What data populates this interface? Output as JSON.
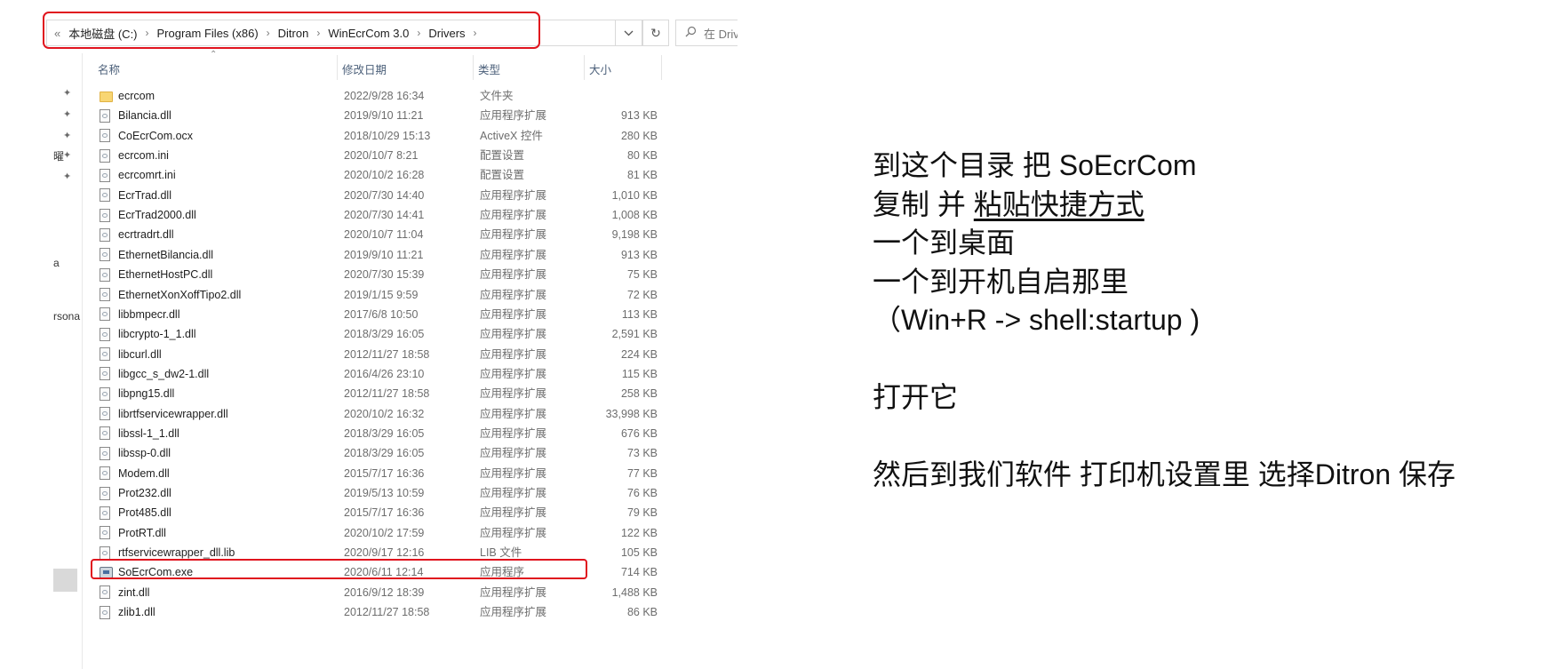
{
  "address_bar": {
    "back_glyph": "«",
    "breadcrumbs": [
      "本地磁盘 (C:)",
      "Program Files (x86)",
      "Ditron",
      "WinEcrCom 3.0",
      "Drivers"
    ],
    "search_placeholder": "在 Driv"
  },
  "nav_pane": {
    "labels": [
      "曜",
      "a",
      "rsona"
    ]
  },
  "columns": {
    "name": "名称",
    "date": "修改日期",
    "type": "类型",
    "size": "大小"
  },
  "files": [
    {
      "name": "ecrcom",
      "date": "2022/9/28 16:34",
      "type": "文件夹",
      "size": "",
      "icon": "folder-icon"
    },
    {
      "name": "Bilancia.dll",
      "date": "2019/9/10 11:21",
      "type": "应用程序扩展",
      "size": "913 KB",
      "icon": "dll-icon"
    },
    {
      "name": "CoEcrCom.ocx",
      "date": "2018/10/29 15:13",
      "type": "ActiveX 控件",
      "size": "280 KB",
      "icon": "ocx-icon"
    },
    {
      "name": "ecrcom.ini",
      "date": "2020/10/7 8:21",
      "type": "配置设置",
      "size": "80 KB",
      "icon": "ini-icon"
    },
    {
      "name": "ecrcomrt.ini",
      "date": "2020/10/2 16:28",
      "type": "配置设置",
      "size": "81 KB",
      "icon": "ini-icon"
    },
    {
      "name": "EcrTrad.dll",
      "date": "2020/7/30 14:40",
      "type": "应用程序扩展",
      "size": "1,010 KB",
      "icon": "dll-icon"
    },
    {
      "name": "EcrTrad2000.dll",
      "date": "2020/7/30 14:41",
      "type": "应用程序扩展",
      "size": "1,008 KB",
      "icon": "dll-icon"
    },
    {
      "name": "ecrtradrt.dll",
      "date": "2020/10/7 11:04",
      "type": "应用程序扩展",
      "size": "9,198 KB",
      "icon": "dll-icon"
    },
    {
      "name": "EthernetBilancia.dll",
      "date": "2019/9/10 11:21",
      "type": "应用程序扩展",
      "size": "913 KB",
      "icon": "dll-icon"
    },
    {
      "name": "EthernetHostPC.dll",
      "date": "2020/7/30 15:39",
      "type": "应用程序扩展",
      "size": "75 KB",
      "icon": "dll-icon"
    },
    {
      "name": "EthernetXonXoffTipo2.dll",
      "date": "2019/1/15 9:59",
      "type": "应用程序扩展",
      "size": "72 KB",
      "icon": "dll-icon"
    },
    {
      "name": "libbmpecr.dll",
      "date": "2017/6/8 10:50",
      "type": "应用程序扩展",
      "size": "113 KB",
      "icon": "dll-icon"
    },
    {
      "name": "libcrypto-1_1.dll",
      "date": "2018/3/29 16:05",
      "type": "应用程序扩展",
      "size": "2,591 KB",
      "icon": "dll-icon"
    },
    {
      "name": "libcurl.dll",
      "date": "2012/11/27 18:58",
      "type": "应用程序扩展",
      "size": "224 KB",
      "icon": "dll-icon"
    },
    {
      "name": "libgcc_s_dw2-1.dll",
      "date": "2016/4/26 23:10",
      "type": "应用程序扩展",
      "size": "115 KB",
      "icon": "dll-icon"
    },
    {
      "name": "libpng15.dll",
      "date": "2012/11/27 18:58",
      "type": "应用程序扩展",
      "size": "258 KB",
      "icon": "dll-icon"
    },
    {
      "name": "librtfservicewrapper.dll",
      "date": "2020/10/2 16:32",
      "type": "应用程序扩展",
      "size": "33,998 KB",
      "icon": "dll-icon"
    },
    {
      "name": "libssl-1_1.dll",
      "date": "2018/3/29 16:05",
      "type": "应用程序扩展",
      "size": "676 KB",
      "icon": "dll-icon"
    },
    {
      "name": "libssp-0.dll",
      "date": "2018/3/29 16:05",
      "type": "应用程序扩展",
      "size": "73 KB",
      "icon": "dll-icon"
    },
    {
      "name": "Modem.dll",
      "date": "2015/7/17 16:36",
      "type": "应用程序扩展",
      "size": "77 KB",
      "icon": "dll-icon"
    },
    {
      "name": "Prot232.dll",
      "date": "2019/5/13 10:59",
      "type": "应用程序扩展",
      "size": "76 KB",
      "icon": "dll-icon"
    },
    {
      "name": "Prot485.dll",
      "date": "2015/7/17 16:36",
      "type": "应用程序扩展",
      "size": "79 KB",
      "icon": "dll-icon"
    },
    {
      "name": "ProtRT.dll",
      "date": "2020/10/2 17:59",
      "type": "应用程序扩展",
      "size": "122 KB",
      "icon": "dll-icon"
    },
    {
      "name": "rtfservicewrapper_dll.lib",
      "date": "2020/9/17 12:16",
      "type": "LIB 文件",
      "size": "105 KB",
      "icon": "lib-icon"
    },
    {
      "name": "SoEcrCom.exe",
      "date": "2020/6/11 12:14",
      "type": "应用程序",
      "size": "714 KB",
      "icon": "exe-icon"
    },
    {
      "name": "zint.dll",
      "date": "2016/9/12 18:39",
      "type": "应用程序扩展",
      "size": "1,488 KB",
      "icon": "dll-icon"
    },
    {
      "name": "zlib1.dll",
      "date": "2012/11/27 18:58",
      "type": "应用程序扩展",
      "size": "86 KB",
      "icon": "dll-icon"
    }
  ],
  "highlight_color": "#e0141e",
  "instructions": {
    "line1": "到这个目录 把 SoEcrCom",
    "line2_a": "复制 并 ",
    "line2_b": "粘贴快捷方式 ",
    "line3": "一个到桌面",
    "line4": "一个到开机自启那里",
    "line5": "（Win+R -> shell:startup )",
    "line6": "打开它",
    "line7": "然后到我们软件 打印机设置里 选择Ditron 保存"
  }
}
